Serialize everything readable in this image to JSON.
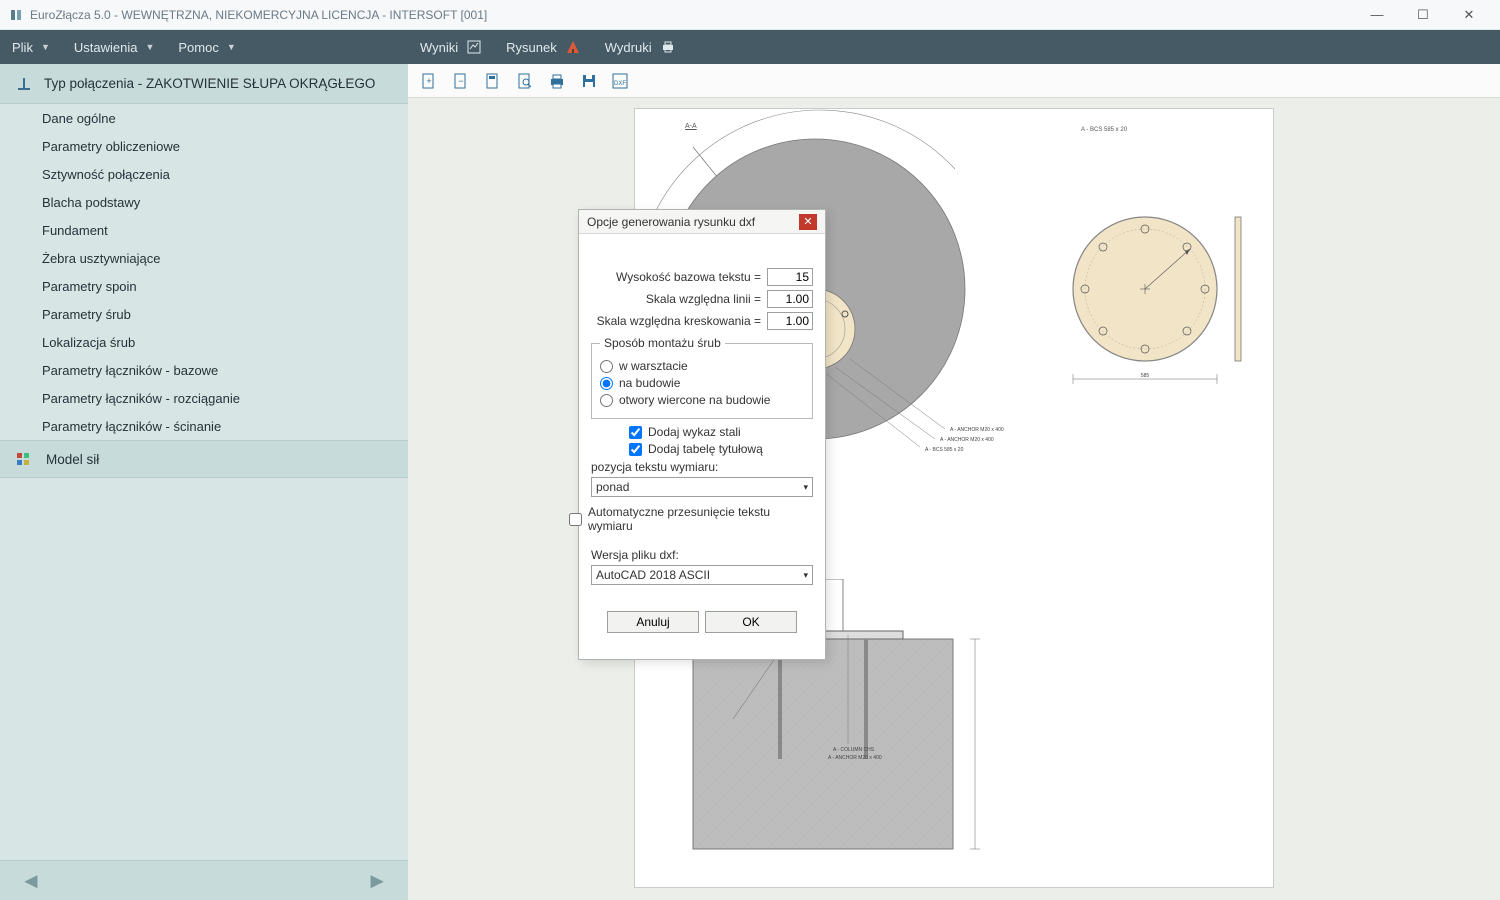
{
  "titlebar": {
    "title": "EuroZłącza 5.0 - WEWNĘTRZNA, NIEKOMERCYJNA LICENCJA - INTERSOFT [001]"
  },
  "menuLeft": {
    "file": "Plik",
    "settings": "Ustawienia",
    "help": "Pomoc"
  },
  "menuRight": {
    "results": "Wyniki",
    "drawing": "Rysunek",
    "prints": "Wydruki"
  },
  "sidebar": {
    "header": "Typ połączenia - ZAKOTWIENIE SŁUPA OKRĄGŁEGO",
    "items": [
      "Dane ogólne",
      "Parametry obliczeniowe",
      "Sztywność połączenia",
      "Blacha podstawy",
      "Fundament",
      "Żebra usztywniające",
      "Parametry spoin",
      "Parametry śrub",
      "Lokalizacja śrub",
      "Parametry łączników - bazowe",
      "Parametry łączników - rozciąganie",
      "Parametry łączników - ścinanie"
    ],
    "section2": "Model sił"
  },
  "toolbar": {
    "icons": [
      "new",
      "open",
      "view",
      "zoom",
      "print",
      "save",
      "dxf"
    ]
  },
  "modal": {
    "title": "Opcje generowania rysunku dxf",
    "labels": {
      "textHeight": "Wysokość bazowa tekstu =",
      "lineScale": "Skala względna linii =",
      "hatchScale": "Skala względna kreskowania =",
      "mounting": "Sposób montażu śrub",
      "opt1": "w warsztacie",
      "opt2": "na budowie",
      "opt3": "otwory wiercone na budowie",
      "chk1": "Dodaj wykaz stali",
      "chk2": "Dodaj tabelę tytułową",
      "dimPos": "pozycja tekstu wymiaru:",
      "dimSel": "ponad",
      "autoShift": "Automatyczne przesunięcie tekstu wymiaru",
      "dxfVer": "Wersja pliku dxf:",
      "dxfSel": "AutoCAD 2018 ASCII",
      "cancel": "Anuluj",
      "ok": "OK"
    },
    "values": {
      "textHeight": "15",
      "lineScale": "1.00",
      "hatchScale": "1.00"
    }
  },
  "drawing": {
    "sectionLabel": "A-A",
    "plateLabel": "A - BCS 585 x 20"
  }
}
